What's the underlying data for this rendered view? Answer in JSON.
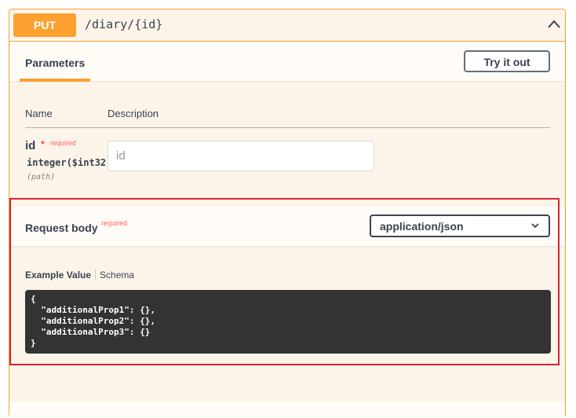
{
  "operation": {
    "method": "PUT",
    "path": "/diary/{id}"
  },
  "parameters_section": {
    "tab_label": "Parameters",
    "try_button_label": "Try it out",
    "columns": {
      "name": "Name",
      "description": "Description"
    },
    "params": [
      {
        "name": "id",
        "required_star": "*",
        "required_label": "required",
        "type": "integer($int32)",
        "location": "(path)",
        "input_placeholder": "id"
      }
    ]
  },
  "request_body": {
    "title": "Request body",
    "required_label": "required",
    "content_type": "application/json",
    "example_tab": "Example Value",
    "schema_tab": "Schema",
    "example_lines": [
      "{",
      "  \"additionalProp1\": {},",
      "  \"additionalProp2\": {},",
      "  \"additionalProp3\": {}",
      "}"
    ]
  },
  "colors": {
    "put_accent": "#fca130",
    "block_background": "#fdf4e9",
    "highlight_border": "#d9232e",
    "code_background": "#333333"
  },
  "icons": {
    "collapse": "chevron-up-icon",
    "dropdown": "chevron-down-icon"
  }
}
